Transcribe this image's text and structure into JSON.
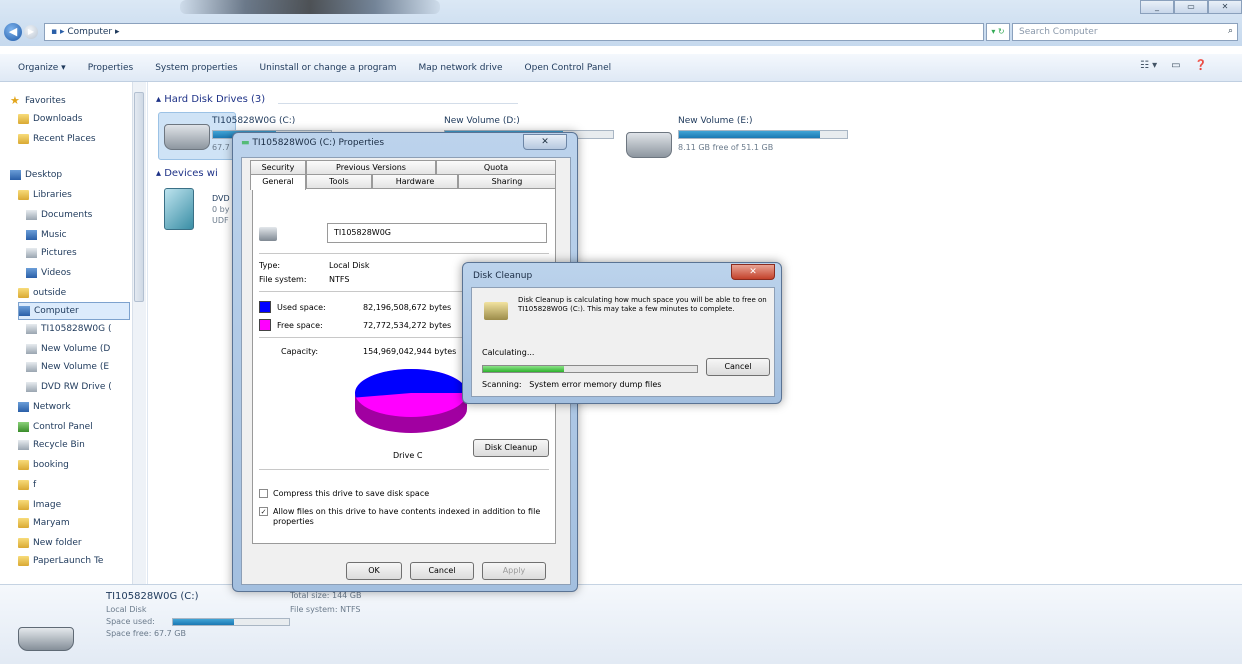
{
  "window": {
    "win_buttons": [
      "_",
      "▭",
      "✕"
    ]
  },
  "address": {
    "path": "Computer",
    "search_placeholder": "Search Computer"
  },
  "toolbar": {
    "items": [
      "Organize ▾",
      "Properties",
      "System properties",
      "Uninstall or change a program",
      "Map network drive",
      "Open Control Panel"
    ]
  },
  "nav": {
    "items": [
      {
        "label": "Favorites",
        "icon": "star-icon"
      },
      {
        "label": "Downloads",
        "icon": "folder-icon"
      },
      {
        "label": "Recent Places",
        "icon": "folder-icon"
      },
      {
        "label": "Desktop",
        "icon": "desktop-icon"
      },
      {
        "label": "Libraries",
        "icon": "library-icon"
      },
      {
        "label": "Documents",
        "icon": "documents-icon"
      },
      {
        "label": "Music",
        "icon": "music-icon"
      },
      {
        "label": "Pictures",
        "icon": "pictures-icon"
      },
      {
        "label": "Videos",
        "icon": "videos-icon"
      },
      {
        "label": "outside",
        "icon": "folder-icon"
      },
      {
        "label": "Computer",
        "icon": "computer-icon"
      },
      {
        "label": "TI105828W0G (",
        "icon": "drive-icon"
      },
      {
        "label": "New Volume (D",
        "icon": "drive-icon"
      },
      {
        "label": "New Volume (E",
        "icon": "drive-icon"
      },
      {
        "label": "DVD RW Drive (",
        "icon": "dvd-icon"
      },
      {
        "label": "Network",
        "icon": "network-icon"
      },
      {
        "label": "Control Panel",
        "icon": "control-panel-icon"
      },
      {
        "label": "Recycle Bin",
        "icon": "recycle-bin-icon"
      },
      {
        "label": "booking",
        "icon": "folder-icon"
      },
      {
        "label": "f",
        "icon": "folder-icon"
      },
      {
        "label": "Image",
        "icon": "folder-icon"
      },
      {
        "label": "Maryam",
        "icon": "folder-icon"
      },
      {
        "label": "New folder",
        "icon": "folder-icon"
      },
      {
        "label": "PaperLaunch Te",
        "icon": "folder-icon"
      }
    ]
  },
  "content": {
    "hdd_header": "Hard Disk Drives (3)",
    "devices_header": "Devices wi",
    "drives": [
      {
        "name": "TI105828W0G (C:)",
        "free_text": "67.7",
        "used_fraction": 0.53
      },
      {
        "name": "New Volume (D:)",
        "free_text": "",
        "used_fraction": 0.7
      },
      {
        "name": "New Volume (E:)",
        "free_text": "8.11 GB free of 51.1 GB",
        "used_fraction": 0.84
      }
    ],
    "dvd": {
      "line1": "DVD",
      "line2": "0 by",
      "line3": "UDF"
    }
  },
  "details": {
    "name": "TI105828W0G (C:)",
    "type": "Local Disk",
    "space_used_label": "Space used:",
    "space_free_label": "Space free:",
    "space_free": "67.7 GB",
    "total_size": "Total size: 144 GB",
    "file_system": "File system: NTFS",
    "used_fraction": 0.53
  },
  "props": {
    "title": "TI105828W0G (C:) Properties",
    "close": "✕",
    "tabs_row1": [
      "Security",
      "Previous Versions",
      "Quota"
    ],
    "tabs_row2": [
      "General",
      "Tools",
      "Hardware",
      "Sharing"
    ],
    "volume_label": "TI105828W0G",
    "type_label": "Type:",
    "type_value": "Local Disk",
    "fs_label": "File system:",
    "fs_value": "NTFS",
    "used_label": "Used space:",
    "used_value": "82,196,508,672 bytes",
    "free_label": "Free space:",
    "free_value": "72,772,534,272 bytes",
    "capacity_label": "Capacity:",
    "capacity_value": "154,969,042,944 bytes",
    "drive_caption": "Drive C",
    "disk_cleanup": "Disk Cleanup",
    "compress_label": "Compress this drive to save disk space",
    "index_label": "Allow files on this drive to have contents indexed in addition to file properties",
    "compress_checked": false,
    "index_checked": true,
    "ok": "OK",
    "cancel": "Cancel",
    "apply": "Apply",
    "colors": {
      "used": "#0000ff",
      "free": "#ff00ff"
    },
    "used_fraction": 0.53
  },
  "cleanup": {
    "title": "Disk Cleanup",
    "close": "✕",
    "message": "Disk Cleanup is calculating how much space you will be able to free on TI105828W0G (C:). This may take a few minutes to complete.",
    "calculating": "Calculating...",
    "cancel": "Cancel",
    "scanning_label": "Scanning:",
    "scanning_value": "System error memory dump files",
    "progress": 0.38
  }
}
